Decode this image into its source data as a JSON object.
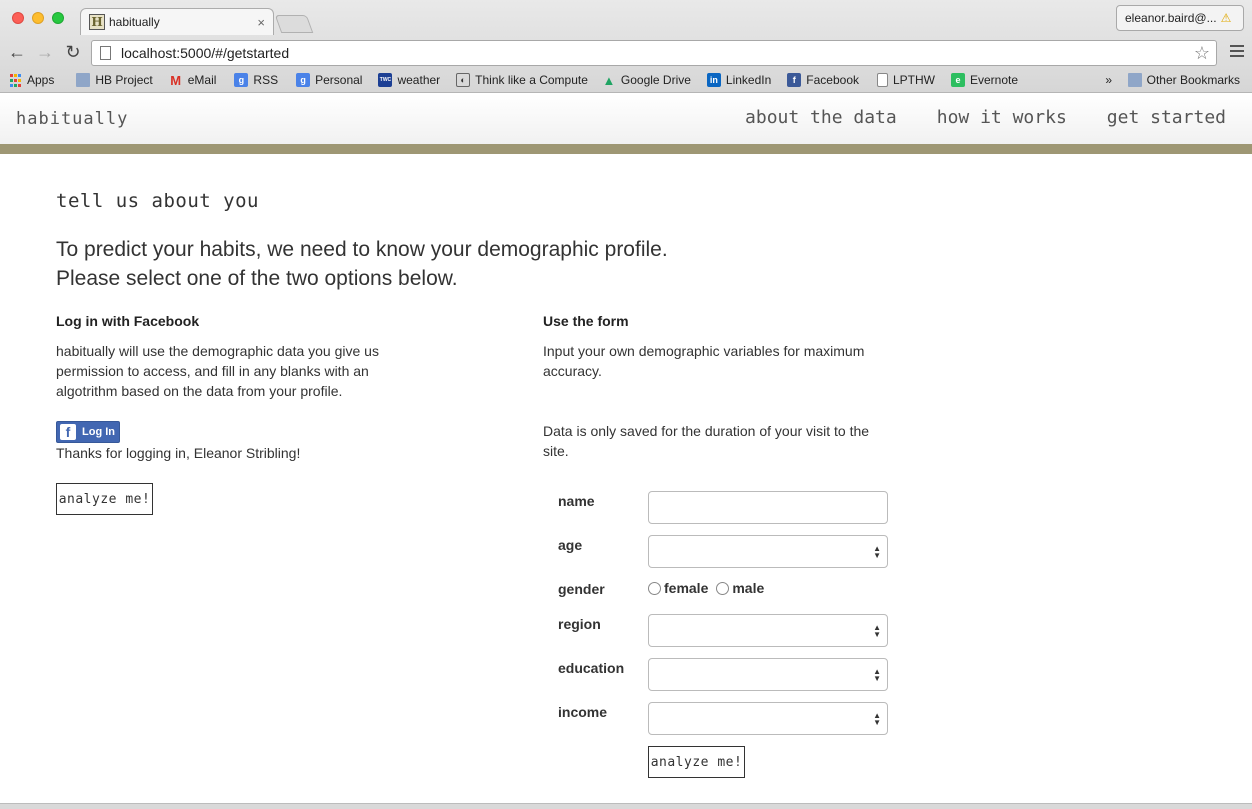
{
  "browser": {
    "tab_title": "habitually",
    "tab_favicon_letter": "H",
    "close_glyph": "×",
    "profile_name": "eleanor.baird@...",
    "url": "localhost:5000/#/getstarted",
    "bookmarks": [
      {
        "label": "Apps",
        "icon": "apps-grid-icon"
      },
      {
        "label": "HB Project",
        "icon": "folder-icon"
      },
      {
        "label": "eMail",
        "icon": "gmail-icon"
      },
      {
        "label": "RSS",
        "icon": "google-icon"
      },
      {
        "label": "Personal",
        "icon": "google-icon"
      },
      {
        "label": "weather",
        "icon": "weather-channel-icon"
      },
      {
        "label": "Think like a Compute",
        "icon": "page-icon"
      },
      {
        "label": "Google Drive",
        "icon": "drive-icon"
      },
      {
        "label": "LinkedIn",
        "icon": "linkedin-icon"
      },
      {
        "label": "Facebook",
        "icon": "facebook-icon"
      },
      {
        "label": "LPTHW",
        "icon": "page-icon"
      },
      {
        "label": "Evernote",
        "icon": "evernote-icon"
      }
    ],
    "more_bookmarks": "»",
    "other_bookmarks": "Other Bookmarks"
  },
  "site": {
    "brand": "habitually",
    "nav": [
      "about the data",
      "how it works",
      "get started"
    ]
  },
  "content": {
    "heading": "tell us about you",
    "intro_line1": "To predict your habits, we need to know your demographic profile.",
    "intro_line2": "Please select one of the two options below.",
    "facebook": {
      "title": "Log in with Facebook",
      "text": "habitually will use the demographic data you give us permission to access, and fill in any blanks with an algotrithm based on the data from your profile.",
      "login_label": "Log In",
      "thanks": "Thanks for logging in, Eleanor Stribling!",
      "analyze_label": "analyze me!"
    },
    "form": {
      "title": "Use the form",
      "text": "Input your own demographic variables for maximum accuracy.",
      "note": "Data is only saved for the duration of your visit to the site.",
      "labels": {
        "name": "name",
        "age": "age",
        "gender": "gender",
        "region": "region",
        "education": "education",
        "income": "income"
      },
      "gender_options": [
        "female",
        "male"
      ],
      "analyze_label": "analyze me!"
    }
  },
  "colors": {
    "accent_band": "#9e9774",
    "facebook_blue": "#4267b2"
  }
}
